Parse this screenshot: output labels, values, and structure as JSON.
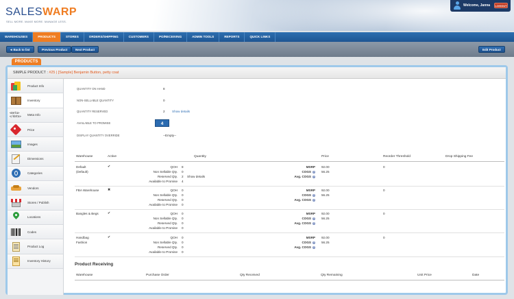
{
  "header": {
    "logo_a": "SALES",
    "logo_b": "WARP",
    "tagline": "SELL MORE. MAKE MORE. MANAGE LESS.",
    "welcome": "Welcome, Janna",
    "logout": "LOGOUT"
  },
  "nav": {
    "items": [
      "WAREHOUSES",
      "PRODUCTS",
      "STORES",
      "ORDERS/SHIPPING",
      "CUSTOMERS",
      "PO/RECEIVING",
      "ADMIN TOOLS",
      "REPORTS",
      "QUICK LINKS"
    ],
    "active_index": 1
  },
  "toolbar": {
    "back": "Back to list",
    "prev": "Previous Product",
    "next": "Next Product",
    "edit": "Edit Product"
  },
  "section_tab": "PRODUCTS",
  "breadcrumb": {
    "prefix": "SIMPLE PRODUCT :",
    "name": "#25 | [Sample] Benjamin Button, petty coat"
  },
  "sidebar": {
    "items": [
      "Product Info",
      "Inventory",
      "Meta Info",
      "Price",
      "Images",
      "Dimensions",
      "Categories",
      "Vendors",
      "Stores / Publish",
      "Locations",
      "Codes",
      "Product Log",
      "Inventory History"
    ],
    "active_index": 1,
    "meta_icon_text": "<meta>\n</data>"
  },
  "summary": {
    "qoh_label": "QUANTITY ON HAND",
    "qoh": "8",
    "nonsell_label": "NON-SELLABLE QUANTITY",
    "nonsell": "0",
    "reserved_label": "QUANTITY RESERVED",
    "reserved": "2",
    "show_details": "Show details",
    "atp_label": "AVAILABLE TO PROMISE",
    "atp": "4",
    "override_label": "DISPLAY QUANTITY OVERRIDE",
    "override": "--Empty--"
  },
  "inv_table": {
    "headers": [
      "Warehouse",
      "Active",
      "Quantity",
      "Price",
      "Reorder Threshold",
      "Drop Shipping Fee"
    ],
    "qty_labels": [
      "QOH",
      "Non Sellable Qty.",
      "Reserved Qty.",
      "Available to Promise"
    ],
    "price_labels": [
      "MSRP",
      "COGS",
      "Avg. COGS"
    ],
    "show_details": "Show details",
    "rows": [
      {
        "warehouse": "Default",
        "sub": "(Default)",
        "active": "✔",
        "qty": [
          "8",
          "0",
          "2",
          "4"
        ],
        "details": true,
        "msrp": "92.00",
        "cogs": "56.25",
        "reorder": "0"
      },
      {
        "warehouse": "FBA Warehouse",
        "sub": "",
        "active": "✖",
        "qty": [
          "0",
          "0",
          "0",
          "0"
        ],
        "details": false,
        "msrp": "92.00",
        "cogs": "56.25",
        "reorder": "0"
      },
      {
        "warehouse": "Bangles & Begs",
        "sub": "",
        "active": "✔",
        "qty": [
          "0",
          "0",
          "0",
          "0"
        ],
        "details": false,
        "msrp": "92.00",
        "cogs": "56.25",
        "reorder": "0"
      },
      {
        "warehouse": "Handbag",
        "sub": "Fashion",
        "active": "✔",
        "qty": [
          "0",
          "0",
          "0",
          "0"
        ],
        "details": false,
        "msrp": "92.00",
        "cogs": "56.25",
        "reorder": "0"
      }
    ]
  },
  "receiving": {
    "title": "Product Receiving",
    "headers": [
      "Warehouse",
      "Purchase Order",
      "Qty Received",
      "Qty Remaining",
      "Unit Price",
      "Date"
    ]
  }
}
